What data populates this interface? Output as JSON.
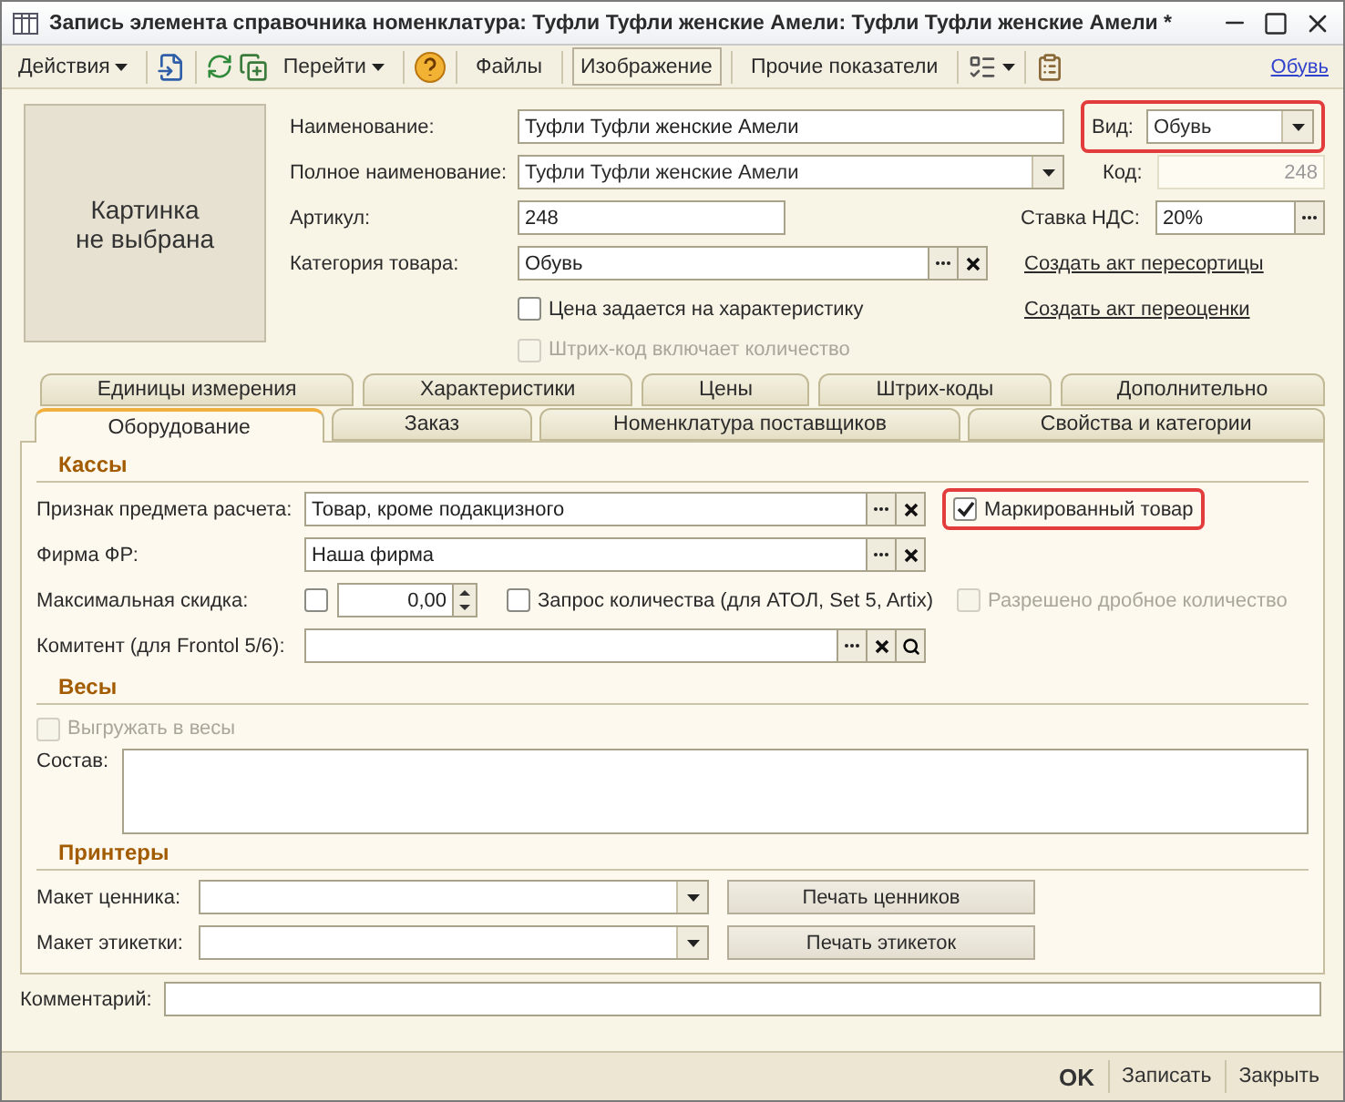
{
  "window": {
    "title": "Запись элемента справочника номенклатура: Туфли Туфли женские Амели: Туфли Туфли женские Амели *"
  },
  "toolbar": {
    "actions": "Действия",
    "goto": "Перейти",
    "buttons": [
      {
        "label": "Файлы",
        "pressed": false
      },
      {
        "label": "Изображение",
        "pressed": true
      },
      {
        "label": "Прочие показатели",
        "pressed": false
      }
    ],
    "link": "Обувь"
  },
  "image_placeholder": "Картинка\nне выбрана",
  "form": {
    "name": {
      "label": "Наименование:",
      "value": "Туфли Туфли женские Амели"
    },
    "full_name": {
      "label": "Полное наименование:",
      "value": "Туфли Туфли женские Амели"
    },
    "article": {
      "label": "Артикул:",
      "value": "248"
    },
    "category": {
      "label": "Категория товара:",
      "value": "Обувь"
    },
    "price_by_characteristic": {
      "label": "Цена задается на характеристику",
      "checked": false,
      "disabled": false
    },
    "barcode_includes_qty": {
      "label": "Штрих-код включает количество",
      "checked": false,
      "disabled": true
    },
    "view": {
      "label": "Вид:",
      "value": "Обувь",
      "highlighted": true
    },
    "code": {
      "label": "Код:",
      "value": "248"
    },
    "vat": {
      "label": "Ставка НДС:",
      "value": "20%"
    },
    "links": [
      "Создать акт пересортицы",
      "Создать акт переоценки"
    ]
  },
  "tabs": {
    "back_row": [
      {
        "label": "Единицы измерения",
        "selected": false
      },
      {
        "label": "Характеристики",
        "selected": false
      },
      {
        "label": "Цены",
        "selected": false
      },
      {
        "label": "Штрих-коды",
        "selected": false
      },
      {
        "label": "Дополнительно",
        "selected": false
      }
    ],
    "front_row": [
      {
        "label": "Оборудование",
        "selected": true
      },
      {
        "label": "Заказ",
        "selected": false
      },
      {
        "label": "Номенклатура поставщиков",
        "selected": false
      },
      {
        "label": "Свойства и категории",
        "selected": false
      }
    ]
  },
  "cash": {
    "title": "Кассы",
    "payment_sign": {
      "label": "Признак предмета расчета:",
      "value": "Товар, кроме подакцизного"
    },
    "marked": {
      "label": "Маркированный товар",
      "checked": true,
      "disabled": false,
      "highlighted": true
    },
    "fr_firm": {
      "label": "Фирма ФР:",
      "value": "Наша фирма"
    },
    "max_discount": {
      "label": "Максимальная скидка:",
      "checked": false,
      "disabled": false,
      "value": "0,00"
    },
    "qty_request": {
      "label": "Запрос количества (для АТОЛ, Set 5, Artix)",
      "checked": false,
      "disabled": false
    },
    "fractional": {
      "label": "Разрешено дробное количество",
      "checked": false,
      "disabled": true
    },
    "consignor": {
      "label": "Комитент (для Frontol 5/6):"
    }
  },
  "scales": {
    "title": "Весы",
    "export": {
      "label": "Выгружать в весы",
      "checked": false,
      "disabled": true
    },
    "composition": {
      "label": "Состав:"
    }
  },
  "printers": {
    "title": "Принтеры",
    "rows": [
      {
        "label": "Макет ценника:",
        "button": "Печать ценников"
      },
      {
        "label": "Макет этикетки:",
        "button": "Печать этикеток"
      }
    ]
  },
  "comment": {
    "label": "Комментарий:"
  },
  "footer": {
    "buttons": [
      {
        "label": "OK",
        "default": true
      },
      {
        "label": "Записать",
        "default": false
      },
      {
        "label": "Закрыть",
        "default": false
      }
    ]
  }
}
